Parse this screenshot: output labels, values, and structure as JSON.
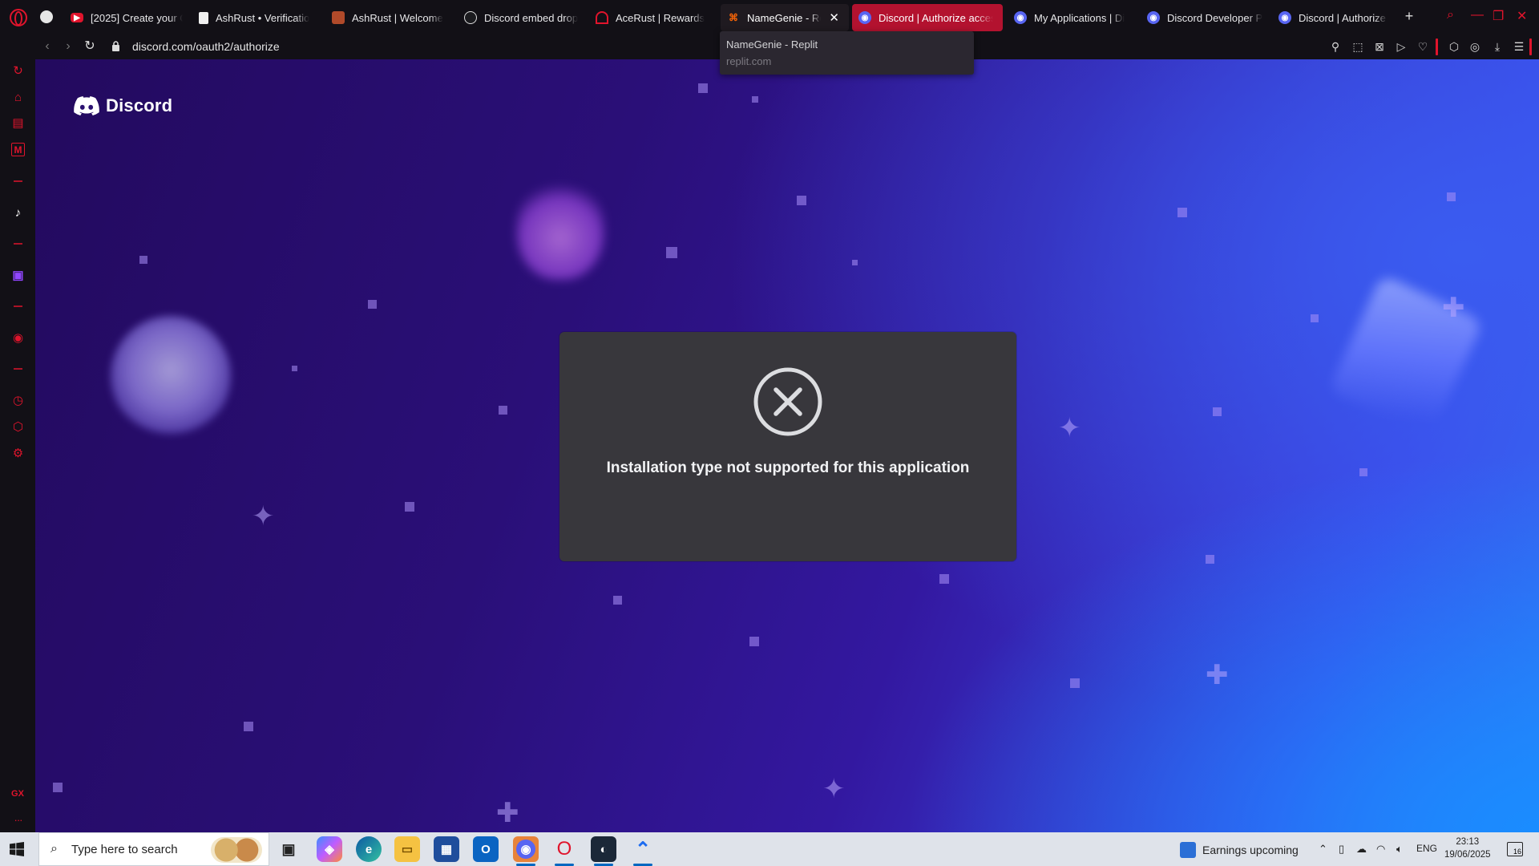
{
  "browser": {
    "tabs": [
      {
        "label": "[2025] Create your O",
        "favicon": "youtube-icon",
        "color": "#e0142c"
      },
      {
        "label": "AshRust • Verificatio",
        "favicon": "document-icon",
        "color": "#ffffff"
      },
      {
        "label": "AshRust | Welcome",
        "favicon": "ashrust-icon",
        "color": "#e06030"
      },
      {
        "label": "Discord embed drop",
        "favicon": "github-icon",
        "color": "#dddddd"
      },
      {
        "label": "AceRust | Rewards",
        "favicon": "acerust-icon",
        "color": "#e0142c"
      },
      {
        "label": "NameGenie - Re",
        "favicon": "replit-icon",
        "color": "#f26207"
      },
      {
        "label": "Discord | Authorize acces",
        "favicon": "discord-icon",
        "color": "#5865f2"
      },
      {
        "label": "My Applications | Di",
        "favicon": "discord-icon",
        "color": "#5865f2"
      },
      {
        "label": "Discord Developer P",
        "favicon": "discord-icon",
        "color": "#5865f2"
      },
      {
        "label": "Discord | Authorize a",
        "favicon": "discord-icon",
        "color": "#5865f2"
      }
    ],
    "url": "discord.com/oauth2/authorize",
    "tooltip": {
      "title": "NameGenie - Replit",
      "domain": "replit.com"
    },
    "accent": "#e0142c"
  },
  "page": {
    "brand": "Discord",
    "error_message": "Installation type not supported for this application",
    "modal_color": "#38373c"
  },
  "sidebar": {
    "items": [
      "aria-icon",
      "cart-icon",
      "history-icon",
      "mail-icon",
      "sep",
      "tiktok-icon",
      "sep",
      "twitch-icon",
      "sep",
      "player-icon",
      "sep",
      "clock-icon",
      "extensions-icon",
      "settings-icon"
    ],
    "bottom_label": "GX",
    "more": "···"
  },
  "taskbar": {
    "search_placeholder": "Type here to search",
    "news": "Earnings upcoming",
    "lang": "ENG",
    "time": "23:13",
    "date": "19/06/2025",
    "notifications": "16"
  }
}
